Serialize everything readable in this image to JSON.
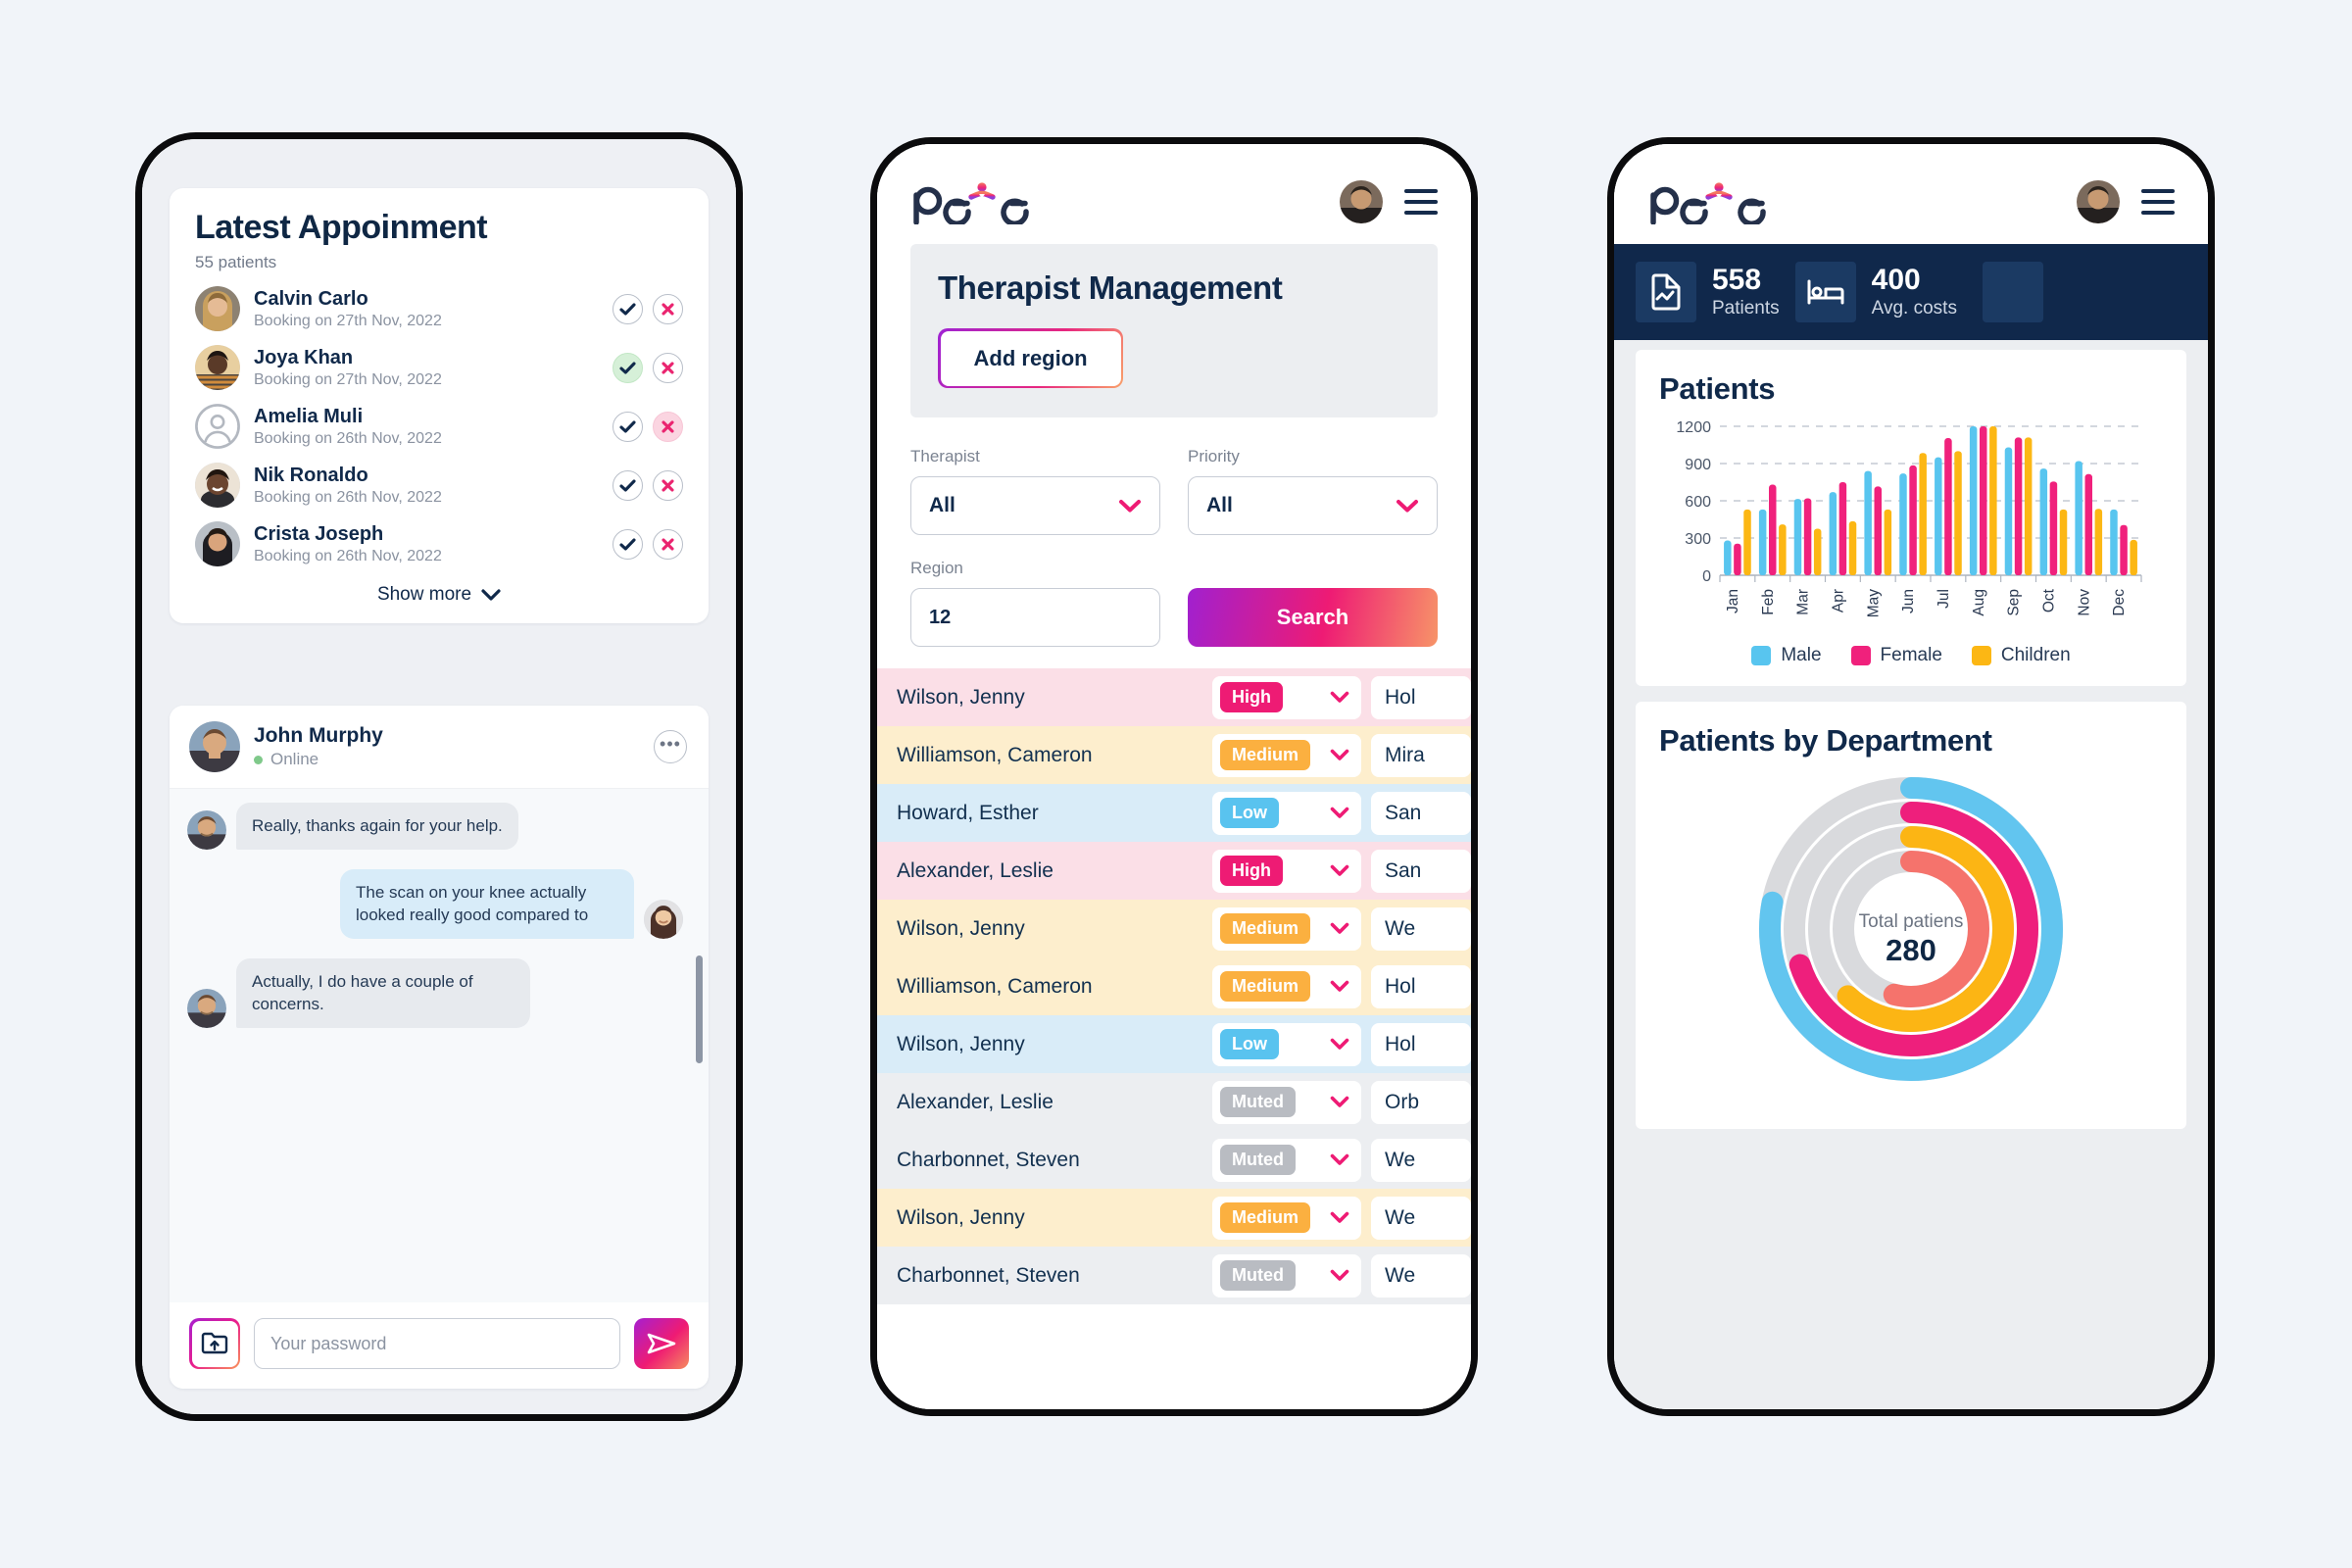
{
  "brand": {
    "logo_text_left": "pe",
    "logo_text_right": "e",
    "logo_name": "peYe",
    "accent_pink": "#ee1b74",
    "accent_purple": "#a120cf",
    "accent_orange": "#f79468",
    "navy": "#10294a"
  },
  "phone1": {
    "appointments": {
      "title": "Latest Appoinment",
      "subtitle": "55 patients",
      "show_more": "Show more",
      "rows": [
        {
          "name": "Calvin Carlo",
          "date": "Booking on 27th Nov, 2022",
          "accept_state": "outline",
          "reject_state": "outline",
          "avatar": "woman-blonde"
        },
        {
          "name": "Joya Khan",
          "date": "Booking on 27th Nov, 2022",
          "accept_state": "filled",
          "reject_state": "outline",
          "avatar": "woman-dark"
        },
        {
          "name": "Amelia Muli",
          "date": "Booking on 26th Nov, 2022",
          "accept_state": "outline",
          "reject_state": "filled",
          "avatar": "placeholder-person"
        },
        {
          "name": "Nik Ronaldo",
          "date": "Booking on 26th Nov, 2022",
          "accept_state": "outline",
          "reject_state": "outline",
          "avatar": "man-smiling"
        },
        {
          "name": "Crista Joseph",
          "date": "Booking on 26th Nov, 2022",
          "accept_state": "outline",
          "reject_state": "outline",
          "avatar": "woman-brunette"
        }
      ]
    },
    "chat": {
      "contact_name": "John Murphy",
      "status": "Online",
      "messages": [
        {
          "dir": "in",
          "text": "Really, thanks again for your help."
        },
        {
          "dir": "out",
          "text": "The scan on your knee actually looked really good compared to"
        },
        {
          "dir": "in",
          "text": "Actually, I do have a couple of concerns."
        }
      ],
      "input_placeholder": "Your password",
      "input_value": ""
    }
  },
  "phone2": {
    "page_title": "Therapist Management",
    "add_region_label": "Add region",
    "filters": {
      "therapist_label": "Therapist",
      "therapist_value": "All",
      "priority_label": "Priority",
      "priority_value": "All",
      "region_label": "Region",
      "region_value": "12",
      "search_label": "Search"
    },
    "table": {
      "rows": [
        {
          "name": "Wilson, Jenny",
          "priority": "High",
          "region": "Hol",
          "tone": "high"
        },
        {
          "name": "Williamson, Cameron",
          "priority": "Medium",
          "region": "Mira",
          "tone": "medium"
        },
        {
          "name": "Howard, Esther",
          "priority": "Low",
          "region": "San",
          "tone": "low"
        },
        {
          "name": "Alexander, Leslie",
          "priority": "High",
          "region": "San",
          "tone": "high"
        },
        {
          "name": "Wilson, Jenny",
          "priority": "Medium",
          "region": "We",
          "tone": "medium"
        },
        {
          "name": "Williamson, Cameron",
          "priority": "Medium",
          "region": "Hol",
          "tone": "medium"
        },
        {
          "name": "Wilson, Jenny",
          "priority": "Low",
          "region": "Hol",
          "tone": "low"
        },
        {
          "name": "Alexander, Leslie",
          "priority": "Muted",
          "region": "Orb",
          "tone": "muted"
        },
        {
          "name": "Charbonnet, Steven",
          "priority": "Muted",
          "region": "We",
          "tone": "muted"
        },
        {
          "name": "Wilson, Jenny",
          "priority": "Medium",
          "region": "We",
          "tone": "medium"
        },
        {
          "name": "Charbonnet, Steven",
          "priority": "Muted",
          "region": "We",
          "tone": "muted"
        }
      ]
    }
  },
  "phone3": {
    "stats": [
      {
        "icon": "report-chart-icon",
        "value": "558",
        "label": "Patients"
      },
      {
        "icon": "hospital-bed-icon",
        "value": "400",
        "label": "Avg. costs"
      }
    ],
    "patients_card_title": "Patients",
    "department_card_title": "Patients by Department",
    "donut_center_label": "Total patiens",
    "donut_center_value": "280"
  },
  "chart_data": [
    {
      "type": "bar",
      "title": "Patients",
      "categories": [
        "Jan",
        "Feb",
        "Mar",
        "Apr",
        "May",
        "Jun",
        "Jul",
        "Aug",
        "Sep",
        "Oct",
        "Nov",
        "Dec"
      ],
      "series": [
        {
          "name": "Male",
          "color": "#58c5ef",
          "values": [
            280,
            530,
            615,
            670,
            840,
            820,
            950,
            1200,
            1030,
            860,
            920,
            530
          ]
        },
        {
          "name": "Female",
          "color": "#f0217c",
          "values": [
            255,
            730,
            620,
            750,
            715,
            885,
            1105,
            1200,
            1110,
            755,
            815,
            405
          ]
        },
        {
          "name": "Children",
          "color": "#fcb714",
          "values": [
            530,
            410,
            375,
            435,
            530,
            985,
            1000,
            1200,
            1110,
            530,
            535,
            285
          ]
        }
      ],
      "ylim": [
        0,
        1200
      ],
      "yticks": [
        0,
        300,
        600,
        900,
        1200
      ],
      "xlabel": "",
      "ylabel": "",
      "grid": true,
      "legend": "bottom"
    },
    {
      "type": "pie",
      "subtype": "radial-bar",
      "title": "Patients by Department",
      "center_label": "Total patiens",
      "center_value": "280",
      "track_color": "#d9dadd",
      "series": [
        {
          "name": "ring-1",
          "color": "#62c5ef",
          "percent": 78
        },
        {
          "name": "ring-2",
          "color": "#ee1f7c",
          "percent": 70
        },
        {
          "name": "ring-3",
          "color": "#fcb514",
          "percent": 62
        },
        {
          "name": "ring-4",
          "color": "#f5736c",
          "percent": 54
        }
      ]
    }
  ]
}
